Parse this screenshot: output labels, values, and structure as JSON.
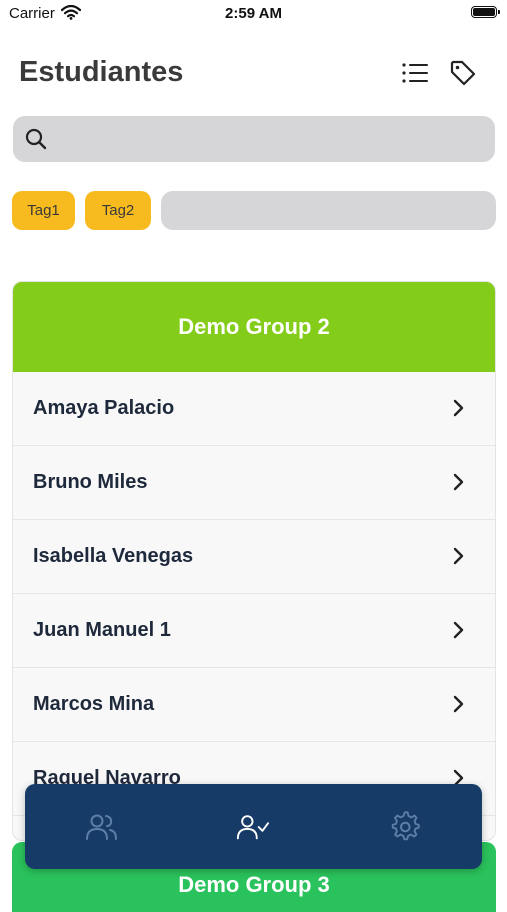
{
  "status_bar": {
    "carrier": "Carrier",
    "time": "2:59 AM"
  },
  "header": {
    "title": "Estudiantes",
    "list_icon": "list-icon",
    "tag_icon": "tag-icon"
  },
  "search": {
    "placeholder": "",
    "value": "",
    "icon": "search-icon"
  },
  "tags": {
    "items": [
      "Tag1",
      "Tag2"
    ],
    "input_value": ""
  },
  "groups": [
    {
      "name": "Demo Group 2",
      "color": "#84cc1a",
      "students": [
        "Amaya Palacio",
        "Bruno Miles",
        "Isabella Venegas",
        "Juan Manuel 1",
        "Marcos Mina",
        "Raquel Navarro"
      ]
    },
    {
      "name": "Demo Group 3",
      "color": "#2ac25c"
    }
  ],
  "tabbar": {
    "color": "#163b66",
    "tabs": [
      {
        "icon": "users-icon",
        "active": false
      },
      {
        "icon": "user-check-icon",
        "active": true
      },
      {
        "icon": "gear-icon",
        "active": false
      }
    ]
  }
}
